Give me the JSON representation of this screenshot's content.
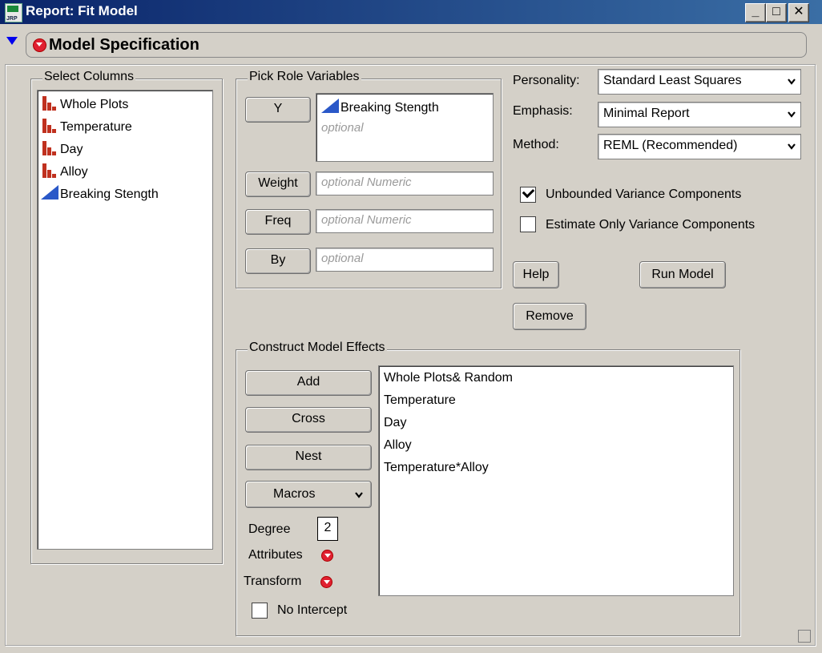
{
  "window": {
    "title": "Report: Fit Model",
    "icon": "jrp-file-icon",
    "controls": [
      "minimize",
      "maximize",
      "close"
    ]
  },
  "outline": {
    "title": "Model Specification"
  },
  "select_columns": {
    "legend": "Select Columns",
    "items": [
      {
        "label": "Whole Plots",
        "icon": "nominal-bar-icon"
      },
      {
        "label": "Temperature",
        "icon": "nominal-bar-icon"
      },
      {
        "label": "Day",
        "icon": "nominal-bar-icon"
      },
      {
        "label": "Alloy",
        "icon": "nominal-bar-icon"
      },
      {
        "label": "Breaking Stength",
        "icon": "continuous-triangle-icon"
      }
    ]
  },
  "pick_roles": {
    "legend": "Pick Role Variables",
    "y": {
      "button": "Y",
      "value": "Breaking Stength",
      "placeholder": "optional"
    },
    "weight": {
      "button": "Weight",
      "placeholder": "optional Numeric"
    },
    "freq": {
      "button": "Freq",
      "placeholder": "optional Numeric"
    },
    "by": {
      "button": "By",
      "placeholder": "optional"
    }
  },
  "options": {
    "personality_label": "Personality:",
    "personality_value": "Standard Least Squares",
    "emphasis_label": "Emphasis:",
    "emphasis_value": "Minimal Report",
    "method_label": "Method:",
    "method_value": "REML (Recommended)",
    "unbounded_label": "Unbounded Variance Components",
    "unbounded_checked": true,
    "estimate_label": "Estimate Only Variance Components",
    "estimate_checked": false
  },
  "actions": {
    "help": "Help",
    "run_model": "Run Model",
    "remove": "Remove"
  },
  "construct": {
    "legend": "Construct Model Effects",
    "add": "Add",
    "cross": "Cross",
    "nest": "Nest",
    "macros": "Macros",
    "degree_label": "Degree",
    "degree_value": "2",
    "attributes_label": "Attributes",
    "transform_label": "Transform",
    "no_intercept_label": "No Intercept",
    "no_intercept_checked": false,
    "effects": [
      "Whole Plots& Random",
      "Temperature",
      "Day",
      "Alloy",
      "Temperature*Alloy"
    ]
  }
}
